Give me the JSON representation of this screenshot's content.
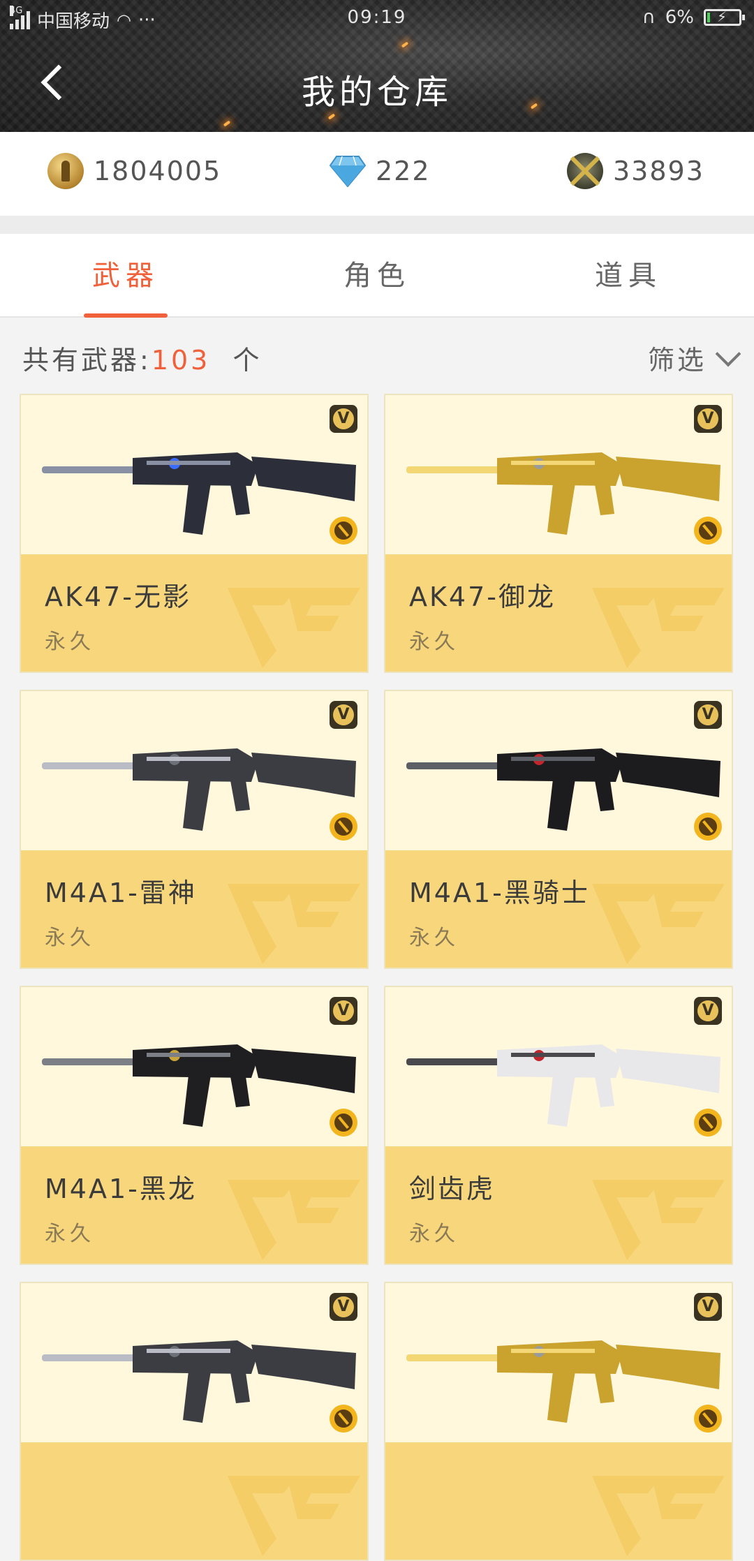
{
  "status_bar": {
    "network": "4G",
    "carrier": "中国移动",
    "more": "···",
    "time": "09:19",
    "battery": "6%",
    "battery_level": 0.06
  },
  "header": {
    "title": "我的仓库"
  },
  "currencies": {
    "coins": "1804005",
    "diamonds": "222",
    "honor": "33893"
  },
  "tabs": [
    {
      "label": "武器",
      "active": true
    },
    {
      "label": "角色",
      "active": false
    },
    {
      "label": "道具",
      "active": false
    }
  ],
  "summary": {
    "prefix": "共有武器:",
    "count": "103",
    "suffix": "个",
    "filter_label": "筛选"
  },
  "weapons": [
    {
      "name": "AK47-无影",
      "duration": "永久",
      "style": "dark-blue"
    },
    {
      "name": "AK47-御龙",
      "duration": "永久",
      "style": "gold"
    },
    {
      "name": "M4A1-雷神",
      "duration": "永久",
      "style": "silver"
    },
    {
      "name": "M4A1-黑骑士",
      "duration": "永久",
      "style": "black-red"
    },
    {
      "name": "M4A1-黑龙",
      "duration": "永久",
      "style": "black-gold"
    },
    {
      "name": "剑齿虎",
      "duration": "永久",
      "style": "white-red"
    },
    {
      "name": "",
      "duration": "",
      "style": "silver"
    },
    {
      "name": "",
      "duration": "",
      "style": "gold"
    }
  ],
  "colors": {
    "accent": "#f0603a",
    "card_bg": "#fff8dd",
    "card_info_bg": "#f8d77c"
  }
}
